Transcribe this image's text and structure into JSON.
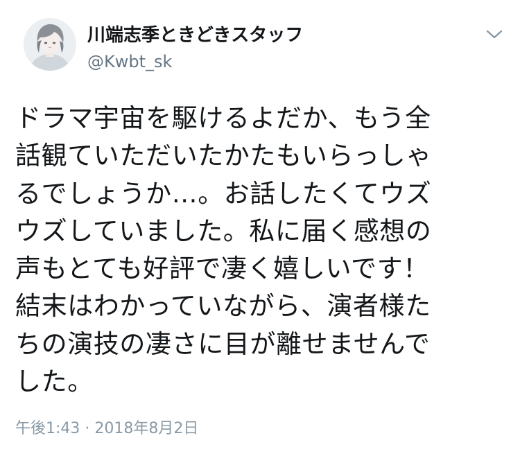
{
  "author": {
    "display_name": "川端志季ときどきスタッフ",
    "handle": "@Kwbt_sk"
  },
  "icons": {
    "avatar": "avatar-illustration",
    "menu": "chevron-down-icon"
  },
  "tweet": {
    "text": "ドラマ宇宙を駆けるよだか、もう全\n話観ていただいたかたもいらっしゃ\nるでしょうか…。お話したくてウズ\nウズしていました。私に届く感想の\n声もとても好評で凄く嬉しいです！\n結末はわかっていながら、演者様た\nちの演技の凄さに目が離せませんで\nした。",
    "timestamp": "午後1:43 · 2018年8月2日"
  },
  "colors": {
    "text": "#14171a",
    "secondary": "#657786",
    "timestamp": "#8899a6"
  }
}
